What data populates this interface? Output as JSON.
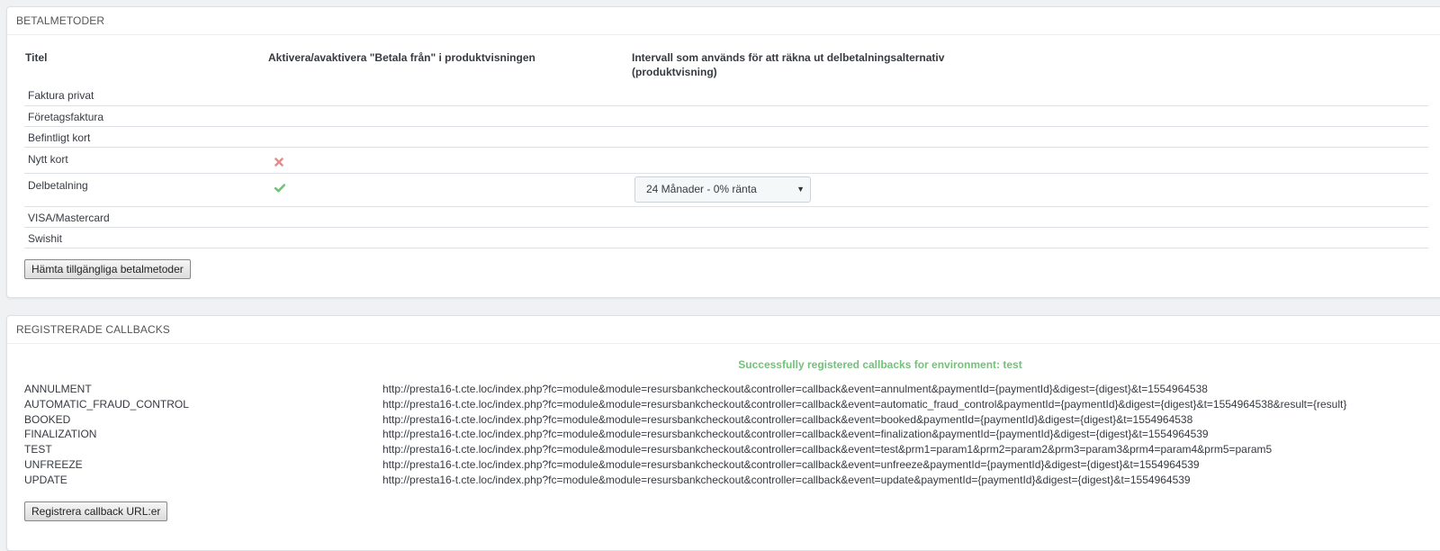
{
  "methods_panel": {
    "heading": "BETALMETODER",
    "columns": [
      "Titel",
      "Aktivera/avaktivera \"Betala från\" i produktvisningen",
      "Intervall som används för att räkna ut delbetalningsalternativ",
      "(produktvisning)"
    ],
    "rows": [
      {
        "title": "Faktura privat"
      },
      {
        "title": "Företagsfaktura"
      },
      {
        "title": "Befintligt kort"
      },
      {
        "title": "Nytt kort",
        "status_icon": "cross-icon"
      },
      {
        "title": "Delbetalning",
        "status_icon": "check-icon",
        "interval": "24 Månader - 0% ränta"
      },
      {
        "title": "VISA/Mastercard"
      },
      {
        "title": "Swishit"
      }
    ],
    "colors": {
      "cross": "#e08e8b",
      "check": "#72c279"
    },
    "fetch_button": "Hämta tillgängliga betalmetoder"
  },
  "callbacks_panel": {
    "heading": "REGISTRERADE CALLBACKS",
    "success_message": "Successfully registered callbacks for environment: test",
    "callbacks": [
      {
        "name": "ANNULMENT",
        "url": "http://presta16-t.cte.loc/index.php?fc=module&module=resursbankcheckout&controller=callback&event=annulment&paymentId={paymentId}&digest={digest}&t=1554964538"
      },
      {
        "name": "AUTOMATIC_FRAUD_CONTROL",
        "url": "http://presta16-t.cte.loc/index.php?fc=module&module=resursbankcheckout&controller=callback&event=automatic_fraud_control&paymentId={paymentId}&digest={digest}&t=1554964538&result={result}"
      },
      {
        "name": "BOOKED",
        "url": "http://presta16-t.cte.loc/index.php?fc=module&module=resursbankcheckout&controller=callback&event=booked&paymentId={paymentId}&digest={digest}&t=1554964538"
      },
      {
        "name": "FINALIZATION",
        "url": "http://presta16-t.cte.loc/index.php?fc=module&module=resursbankcheckout&controller=callback&event=finalization&paymentId={paymentId}&digest={digest}&t=1554964539"
      },
      {
        "name": "TEST",
        "url": "http://presta16-t.cte.loc/index.php?fc=module&module=resursbankcheckout&controller=callback&event=test&prm1=param1&prm2=param2&prm3=param3&prm4=param4&prm5=param5"
      },
      {
        "name": "UNFREEZE",
        "url": "http://presta16-t.cte.loc/index.php?fc=module&module=resursbankcheckout&controller=callback&event=unfreeze&paymentId={paymentId}&digest={digest}&t=1554964539"
      },
      {
        "name": "UPDATE",
        "url": "http://presta16-t.cte.loc/index.php?fc=module&module=resursbankcheckout&controller=callback&event=update&paymentId={paymentId}&digest={digest}&t=1554964539"
      }
    ],
    "register_button": "Registrera callback URL:er"
  }
}
